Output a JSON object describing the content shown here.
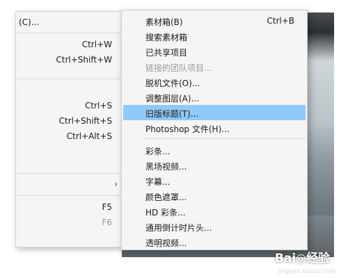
{
  "parent_menu": {
    "top_label": "(C)...",
    "items": [
      {
        "label": "",
        "shortcut": "Ctrl+W"
      },
      {
        "label": "",
        "shortcut": "Ctrl+Shift+W"
      },
      {
        "label": "",
        "shortcut": "Ctrl+S"
      },
      {
        "label": "",
        "shortcut": "Ctrl+Shift+S"
      },
      {
        "label": "",
        "shortcut": "Ctrl+Alt+S"
      },
      {
        "label": "",
        "shortcut": "F5"
      },
      {
        "label": "",
        "shortcut": "F6"
      }
    ],
    "submenu_arrow": "›"
  },
  "submenu": {
    "items": [
      {
        "label": "素材箱(B)",
        "shortcut": "Ctrl+B",
        "disabled": false
      },
      {
        "label": "搜索素材箱",
        "shortcut": "",
        "disabled": false
      },
      {
        "label": "已共享项目",
        "shortcut": "",
        "disabled": false
      },
      {
        "label": "链接的团队项目...",
        "shortcut": "",
        "disabled": true
      },
      {
        "label": "脱机文件(O)...",
        "shortcut": "",
        "disabled": false
      },
      {
        "label": "调整图层(A)...",
        "shortcut": "",
        "disabled": false
      },
      {
        "label": "旧版标题(T)...",
        "shortcut": "",
        "disabled": false,
        "highlighted": true
      },
      {
        "label": "Photoshop 文件(H)...",
        "shortcut": "",
        "disabled": false
      },
      {
        "label": "彩条...",
        "shortcut": "",
        "disabled": false
      },
      {
        "label": "黑场视频...",
        "shortcut": "",
        "disabled": false
      },
      {
        "label": "字幕...",
        "shortcut": "",
        "disabled": false
      },
      {
        "label": "颜色遮罩...",
        "shortcut": "",
        "disabled": false
      },
      {
        "label": "HD 彩条...",
        "shortcut": "",
        "disabled": false
      },
      {
        "label": "通用倒计时片头...",
        "shortcut": "",
        "disabled": false
      },
      {
        "label": "透明视频...",
        "shortcut": "",
        "disabled": false
      }
    ]
  },
  "watermark": {
    "text": "Bai◎经验",
    "url": "jingyan.baidu.com"
  },
  "colors": {
    "highlight": "#91c9f7",
    "menu_bg": "#f5f5f5",
    "disabled_text": "#9a9a9a"
  }
}
